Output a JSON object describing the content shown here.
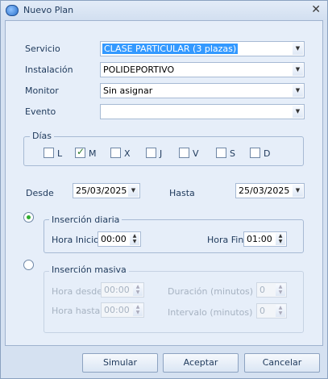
{
  "window": {
    "title": "Nuevo Plan",
    "close_label": "✕"
  },
  "form": {
    "servicio": {
      "label": "Servicio",
      "value": "CLASE PARTICULAR (3 plazas)"
    },
    "instalacion": {
      "label": "Instalación",
      "value": "POLIDEPORTIVO"
    },
    "monitor": {
      "label": "Monitor",
      "value": "Sin asignar"
    },
    "evento": {
      "label": "Evento",
      "value": ""
    }
  },
  "dias": {
    "title": "Días",
    "items": [
      {
        "label": "L",
        "checked": false
      },
      {
        "label": "M",
        "checked": true
      },
      {
        "label": "X",
        "checked": false
      },
      {
        "label": "J",
        "checked": false
      },
      {
        "label": "V",
        "checked": false
      },
      {
        "label": "S",
        "checked": false
      },
      {
        "label": "D",
        "checked": false
      }
    ]
  },
  "dates": {
    "desde_label": "Desde",
    "desde_value": "25/03/2025",
    "hasta_label": "Hasta",
    "hasta_value": "25/03/2025"
  },
  "diaria": {
    "title": "Inserción diaria",
    "selected": true,
    "hora_inicio_label": "Hora Inicio",
    "hora_inicio_value": "00:00",
    "hora_fin_label": "Hora Fin",
    "hora_fin_value": "01:00"
  },
  "masiva": {
    "title": "Inserción masiva",
    "selected": false,
    "hora_desde_label": "Hora desde",
    "hora_desde_value": "00:00",
    "hora_hasta_label": "Hora hasta",
    "hora_hasta_value": "00:00",
    "duracion_label": "Duración (minutos)",
    "duracion_value": "0",
    "intervalo_label": "Intervalo (minutos)",
    "intervalo_value": "0"
  },
  "buttons": {
    "simular": "Simular",
    "aceptar": "Aceptar",
    "cancelar": "Cancelar"
  }
}
